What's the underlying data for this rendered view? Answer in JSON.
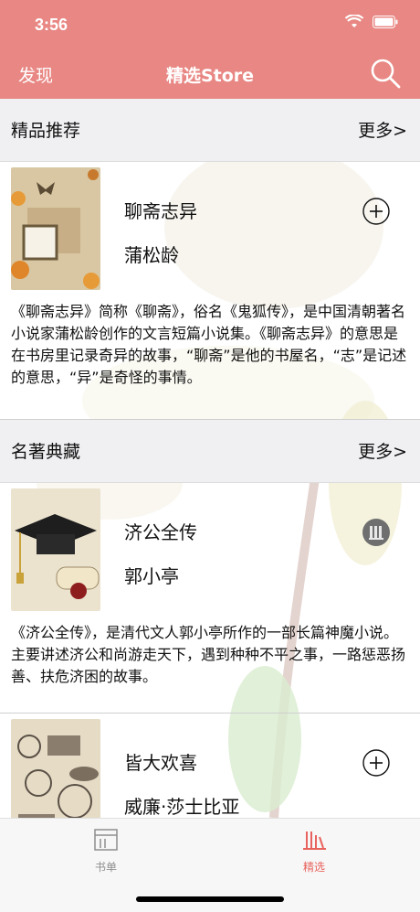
{
  "status": {
    "time": "3:56"
  },
  "nav": {
    "left": "发现",
    "title": "精选Store"
  },
  "sections": [
    {
      "title": "精品推荐",
      "more": "更多>"
    },
    {
      "title": "名著典藏",
      "more": "更多>"
    }
  ],
  "books": [
    {
      "title": "聊斋志异",
      "author": "蒲松龄",
      "action": "plus-circle-icon",
      "desc": "《聊斋志异》简称《聊斋》，俗名《鬼狐传》，是中国清朝著名小说家蒲松龄创作的文言短篇小说集。《聊斋志异》的意思是在书房里记录奇异的故事，“聊斋”是他的书屋名，“志”是记述的意思，“异”是奇怪的事情。"
    },
    {
      "title": "济公全传",
      "author": "郭小亭",
      "action": "library-icon",
      "desc": "《济公全传》，是清代文人郭小亭所作的一部长篇神魔小说。主要讲述济公和尚游走天下，遇到种种不平之事，一路惩恶扬善、扶危济困的故事。"
    },
    {
      "title": "皆大欢喜",
      "author": "威廉·莎士比亚",
      "action": "plus-circle-icon",
      "desc": ""
    }
  ],
  "tabbar": {
    "tabs": [
      {
        "label": "书单"
      },
      {
        "label": "精选"
      }
    ]
  },
  "colors": {
    "accent": "#e88783",
    "tab_active": "#e8635d",
    "tab_inactive": "#8e8e8e"
  }
}
